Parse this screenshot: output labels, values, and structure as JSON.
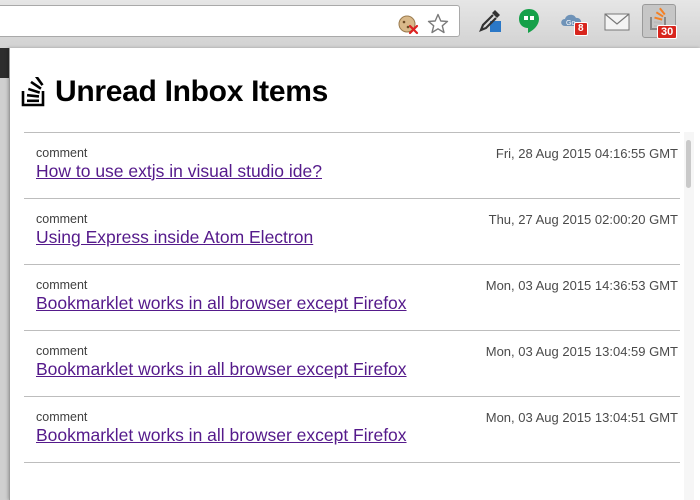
{
  "browser": {
    "extensions": [
      {
        "icon": "eyedropper-icon"
      },
      {
        "icon": "hangouts-icon"
      },
      {
        "icon": "cloud-sync-icon",
        "badge": "8"
      },
      {
        "icon": "mail-icon"
      },
      {
        "icon": "stackexchange-icon",
        "badge": "30"
      }
    ],
    "omnibox_icons": [
      "blocked-cookie-icon",
      "star-icon"
    ]
  },
  "popup": {
    "title": "Unread Inbox Items",
    "items": [
      {
        "type": "comment",
        "date": "Fri, 28 Aug 2015 04:16:55 GMT",
        "title": "How to use extjs in visual studio ide?"
      },
      {
        "type": "comment",
        "date": "Thu, 27 Aug 2015 02:00:20 GMT",
        "title": "Using Express inside Atom Electron"
      },
      {
        "type": "comment",
        "date": "Mon, 03 Aug 2015 14:36:53 GMT",
        "title": "Bookmarklet works in all browser except Firefox"
      },
      {
        "type": "comment",
        "date": "Mon, 03 Aug 2015 13:04:59 GMT",
        "title": "Bookmarklet works in all browser except Firefox"
      },
      {
        "type": "comment",
        "date": "Mon, 03 Aug 2015 13:04:51 GMT",
        "title": "Bookmarklet works in all browser except Firefox"
      }
    ]
  },
  "colors": {
    "link": "#551a8b",
    "badge": "#d8251d",
    "stackexchange_orange": "#f48024"
  }
}
